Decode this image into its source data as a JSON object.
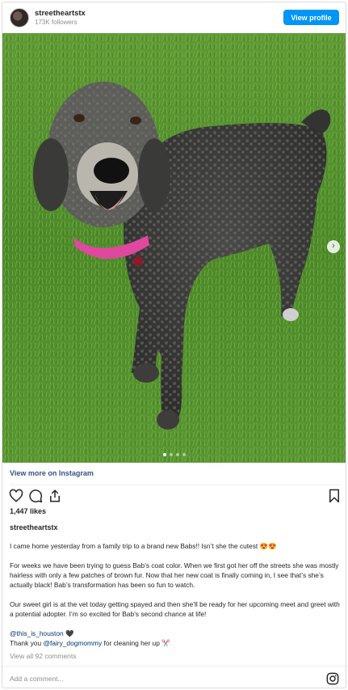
{
  "header": {
    "username": "streetheartstx",
    "followers": "173K followers",
    "view_profile_label": "View profile"
  },
  "post": {
    "view_more_label": "View more on Instagram",
    "likes": "1,447 likes",
    "caption_username": "streetheartstx",
    "caption_paragraphs": {
      "p1": "I came home yesterday from a family trip to a brand new Babs!! Isn’t she the cutest 😍😍",
      "p2": "For weeks we have been trying to guess Bab’s coat color. When we first got her off the streets she was mostly hairless with only a few patches of brown fur. Now that her new coat is finally coming in, I see that’s she’s actually black! Bab’s transformation has been so fun to watch.",
      "p3": "Our sweet girl is at the vet today getting spayed and then she’ll be ready for her upcoming meet and greet with a potential adopter. I’m so excited for Bab’s second chance at life!",
      "mention1": "@this_is_houston",
      "mention1_suffix": " 🖤",
      "thanks_prefix": "Thank you ",
      "mention2": "@fairy_dogmommy",
      "thanks_suffix": " for cleaning her up ✂️"
    },
    "view_all_comments": "View all 92 comments",
    "add_comment_placeholder": "Add a comment..."
  },
  "icons": {
    "like": "heart-icon",
    "comment": "comment-icon",
    "share": "share-icon",
    "save": "bookmark-icon",
    "brand": "instagram-icon",
    "carousel_next": "chevron-right-icon"
  },
  "colors": {
    "accent": "#0095f6",
    "link": "#385185",
    "mention": "#00376b",
    "muted": "#8e8e8e"
  }
}
